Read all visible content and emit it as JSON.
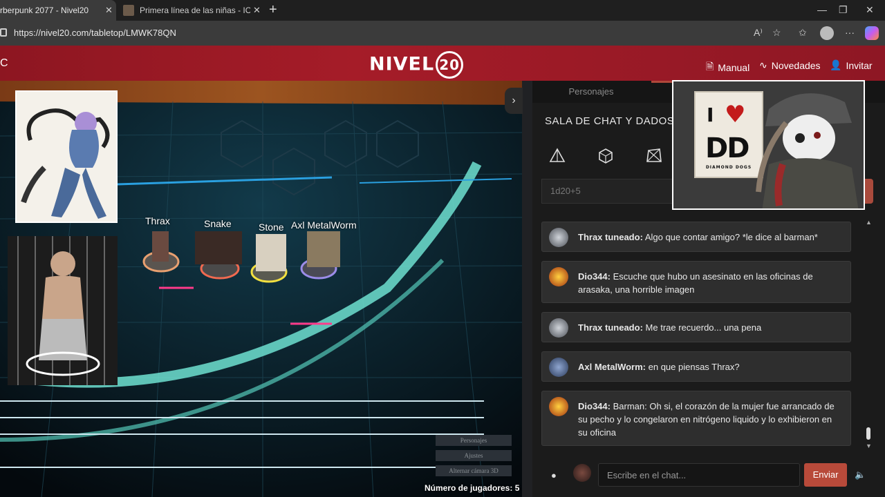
{
  "browser": {
    "tabs": [
      {
        "title": "rberpunk 2077 - Nivel20",
        "active": true
      },
      {
        "title": "Primera línea de las niñas - IOP W",
        "active": false
      }
    ],
    "url": "https://nivel20.com/tabletop/LMWK78QN"
  },
  "header": {
    "logo_text": "NIVEL",
    "logo_number": "20",
    "nav": [
      {
        "label": "Manual",
        "icon": "book-icon"
      },
      {
        "label": "Novedades",
        "icon": "pulse-icon"
      },
      {
        "label": "Invitar",
        "icon": "add-user-icon"
      }
    ]
  },
  "map": {
    "tokens": [
      "Thrax",
      "Snake",
      "Stone",
      "Axl MetalWorm"
    ],
    "buttons": [
      "Personajes",
      "Ajustes",
      "Alternar cámara 3D"
    ],
    "players_count_text": "Número de jugadores: 5"
  },
  "panel": {
    "tabs": [
      "Personajes"
    ],
    "title": "SALA DE CHAT Y DADOS",
    "dice_input_value": "1d20+5",
    "messages": [
      {
        "author": "Thrax tuneado:",
        "text": "Algo que contar amigo? *le dice al barman*",
        "avatar_color": "#8a8f96"
      },
      {
        "author": "Dio344:",
        "text": "Escuche que hubo un asesinato en las oficinas de arasaka, una horrible imagen",
        "avatar_color": "#e0a020"
      },
      {
        "author": "Thrax tuneado:",
        "text": "Me trae recuerdo... una pena",
        "avatar_color": "#8a8f96"
      },
      {
        "author": "Axl MetalWorm:",
        "text": "en que piensas Thrax?",
        "avatar_color": "#4a5f86"
      },
      {
        "author": "Dio344:",
        "text": "Barman: Oh si, el corazón de la mujer fue arrancado de su pecho y lo congelaron en nitrógeno liquido y lo exhibieron en su oficina",
        "avatar_color": "#e0a020"
      }
    ],
    "chat_placeholder": "Escribe en el chat...",
    "send_label": "Enviar"
  },
  "overlay": {
    "sign_i": "I",
    "sign_heart": "♥",
    "sign_dd": "DD",
    "sign_sub": "DIAMOND DOGS"
  }
}
